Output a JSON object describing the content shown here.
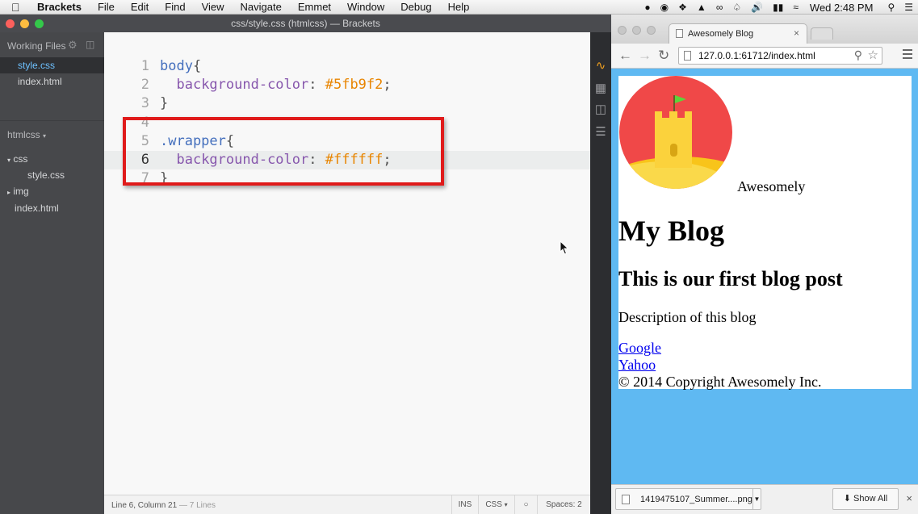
{
  "menubar": {
    "app": "Brackets",
    "items": [
      "File",
      "Edit",
      "Find",
      "View",
      "Navigate",
      "Emmet",
      "Window",
      "Debug",
      "Help"
    ],
    "clock": "Wed 2:48 PM",
    "icons": [
      "dropbox-icon",
      "drive-icon",
      "notification-icon",
      "volume-icon",
      "battery-icon",
      "wifi-icon",
      "spotlight-search-icon",
      "list-icon"
    ]
  },
  "brackets": {
    "title": "css/style.css (htmlcss) — Brackets",
    "working_files_title": "Working Files",
    "working_files": [
      "style.css",
      "index.html"
    ],
    "project_name": "htmlcss",
    "tree": {
      "css_folder": "css",
      "css_file": "style.css",
      "img_folder": "img",
      "index_file": "index.html"
    },
    "code": [
      {
        "n": "1",
        "sel": "body",
        "prop": "",
        "val": ""
      },
      {
        "n": "2",
        "sel": "",
        "prop": "background-color",
        "val": "#5fb9f2"
      },
      {
        "n": "3",
        "sel": "",
        "prop": "",
        "val": ""
      },
      {
        "n": "4",
        "sel": "",
        "prop": "",
        "val": ""
      },
      {
        "n": "5",
        "sel": ".wrapper",
        "prop": "",
        "val": ""
      },
      {
        "n": "6",
        "sel": "",
        "prop": "background-color",
        "val": "#ffffff"
      },
      {
        "n": "7",
        "sel": "",
        "prop": "",
        "val": ""
      }
    ],
    "status": {
      "position": "Line 6, Column 21",
      "lines": "— 7 Lines",
      "mode": "INS",
      "language": "CSS",
      "spaces": "Spaces: 2"
    },
    "colors": {
      "selector": "#446fbd",
      "property": "#8757ad",
      "value": "#e88501",
      "highlight_box": "#e01a1a"
    }
  },
  "browser": {
    "tab_title": "Awesomely Blog",
    "url": "127.0.0.1:61712/index.html",
    "page": {
      "site_name": "Awesomely",
      "heading": "My Blog",
      "post_title": "This is our first blog post",
      "description": "Description of this blog",
      "links": [
        "Google",
        "Yahoo"
      ],
      "copyright": "© 2014 Copyright Awesomely Inc."
    },
    "download": {
      "file": "1419475107_Summer....png",
      "show_all": "Show All"
    },
    "colors": {
      "page_background": "#5fb9f2",
      "wrapper_background": "#ffffff"
    }
  }
}
